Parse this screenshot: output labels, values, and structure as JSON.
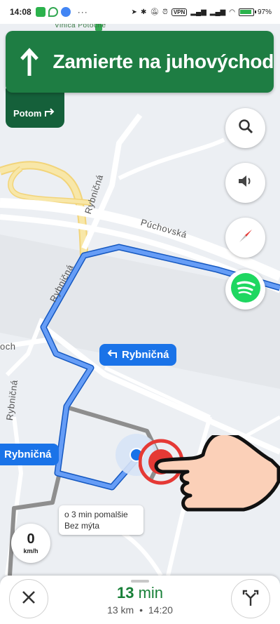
{
  "status_bar": {
    "time": "14:08",
    "battery_percent": "97",
    "vpn_label": "VPN"
  },
  "map": {
    "poi_label": "Vinica Potočné",
    "streets": {
      "puchovska": "Púchovská",
      "rybnicna_1": "Rybničná",
      "rybnicna_2": "Rybničná",
      "rybnicna_3": "Rybničná",
      "partial_left": "och"
    }
  },
  "navigation": {
    "instruction": "Zamierte na juhovýchod",
    "then_label": "Potom",
    "next_turn_street": "Rybničná",
    "side_street_label": "Rybničná",
    "alt_route_info_line1": "o 3 min pomalšie",
    "alt_route_info_line2": "Bez mýta"
  },
  "speedometer": {
    "value": "0",
    "unit": "km/h"
  },
  "trip": {
    "duration_value": "13",
    "duration_unit": "min",
    "distance": "13 km",
    "separator": "•",
    "arrival_time": "14:20"
  },
  "icons": {
    "search": "search-icon",
    "sound": "volume-icon",
    "compass": "compass-icon",
    "spotify": "spotify-icon",
    "close": "close-icon",
    "alternate_routes": "fork-routes-icon",
    "straight": "arrow-up-icon",
    "then_turn": "turn-right-icon",
    "turn_left": "turn-left-icon"
  },
  "colors": {
    "nav_green": "#1e7d43",
    "route_blue": "#1a73e8",
    "spotify_green": "#1ed760",
    "eta_green": "#188038"
  }
}
